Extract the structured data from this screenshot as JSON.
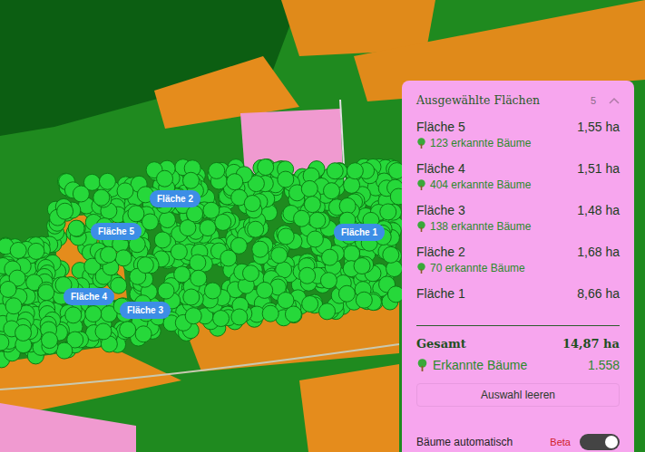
{
  "map": {
    "labels": [
      {
        "text": "Fläche 2"
      },
      {
        "text": "Fläche 5"
      },
      {
        "text": "Fläche 1"
      },
      {
        "text": "Fläche 4"
      },
      {
        "text": "Fläche 3"
      }
    ]
  },
  "panel": {
    "title": "Ausgewählte Flächen",
    "count": "5",
    "expanded": true,
    "items": [
      {
        "name": "Fläche 5",
        "area": "1,55 ha",
        "trees": "123 erkannte Bäume"
      },
      {
        "name": "Fläche 4",
        "area": "1,51 ha",
        "trees": "404 erkannte Bäume"
      },
      {
        "name": "Fläche 3",
        "area": "1,48 ha",
        "trees": "138 erkannte Bäume"
      },
      {
        "name": "Fläche 2",
        "area": "1,68 ha",
        "trees": "70 erkannte Bäume"
      },
      {
        "name": "Fläche 1",
        "area": "8,66 ha",
        "trees": ""
      }
    ],
    "total": {
      "label": "Gesamt",
      "value": "14,87 ha"
    },
    "trees_total": {
      "label": "Erkannte Bäume",
      "value": "1.558"
    },
    "clear_button": "Auswahl leeren",
    "auto_detect": {
      "label": "Bäume automatisch",
      "badge": "Beta",
      "on": true
    }
  }
}
